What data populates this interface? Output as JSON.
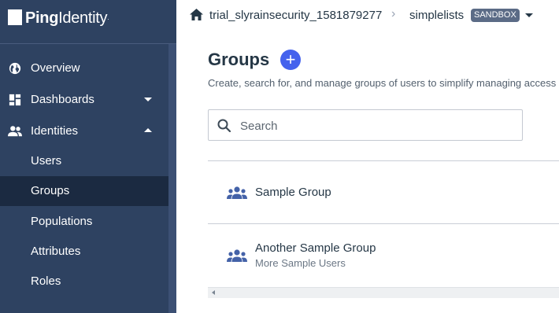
{
  "brand": {
    "name_bold": "Ping",
    "name_light": "Identity",
    "trademark": "."
  },
  "sidebar": {
    "items": [
      {
        "label": "Overview",
        "icon": "globe-icon",
        "expandable": false
      },
      {
        "label": "Dashboards",
        "icon": "dashboard-icon",
        "expandable": true,
        "expanded": false
      },
      {
        "label": "Identities",
        "icon": "people-icon",
        "expandable": true,
        "expanded": true
      },
      {
        "label": "Users",
        "sub": true
      },
      {
        "label": "Groups",
        "sub": true,
        "active": true
      },
      {
        "label": "Populations",
        "sub": true
      },
      {
        "label": "Attributes",
        "sub": true
      },
      {
        "label": "Roles",
        "sub": true
      }
    ]
  },
  "topbar": {
    "environment": "trial_slyrainsecurity_1581879277",
    "separator": "›",
    "app": "simplelists",
    "badge": "SANDBOX"
  },
  "page": {
    "title": "Groups",
    "add_label": "+",
    "subtitle": "Create, search for, and manage groups of users to simplify managing access",
    "search": {
      "placeholder": "Search",
      "value": ""
    }
  },
  "groups": [
    {
      "name": "Sample Group",
      "description": ""
    },
    {
      "name": "Another Sample Group",
      "description": "More Sample Users"
    }
  ],
  "colors": {
    "sidebar_bg": "#2e4261",
    "sidebar_active": "#1b2a41",
    "accent": "#4462ed",
    "group_icon": "#4462a8"
  }
}
